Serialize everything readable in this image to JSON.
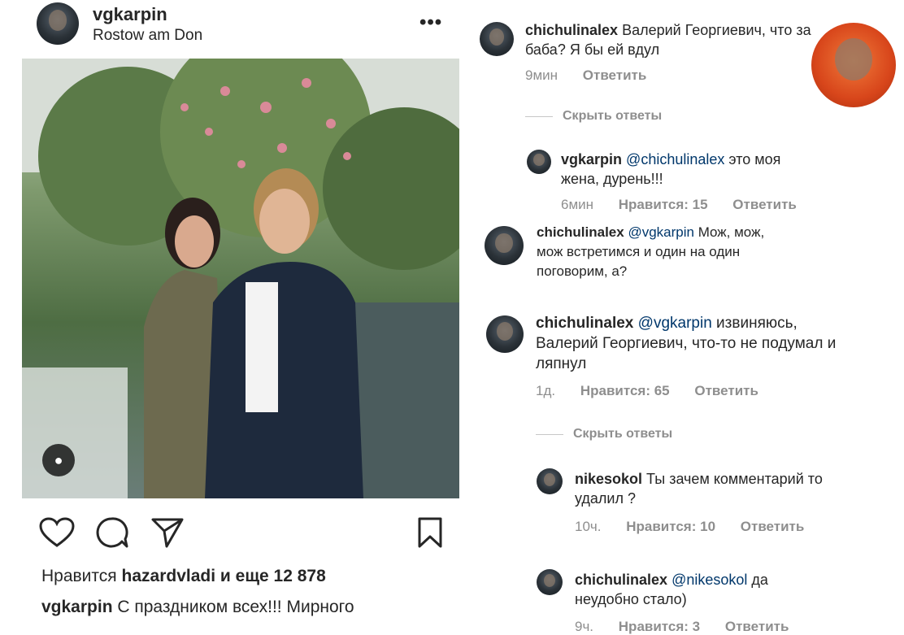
{
  "post": {
    "username": "vgkarpin",
    "location": "Rostow am Don",
    "more_icon": "more-dots-icon",
    "likes_prefix": "Нравится",
    "likes_user": "hazardvladi",
    "likes_suffix": "и еще 12 878",
    "caption_user": "vgkarpin",
    "caption_text": "С праздником всех!!! Мирного"
  },
  "comments": [
    {
      "user": "chichulinalex",
      "mention": "",
      "text": "Валерий Георгиевич, что за баба? Я бы ей вдул",
      "time": "9мин",
      "likes": "",
      "reply": "Ответить"
    },
    {
      "user": "vgkarpin",
      "mention": "@chichulinalex",
      "text": "это моя жена, дурень!!!",
      "time": "6мин",
      "likes": "Нравится: 15",
      "reply": "Ответить"
    },
    {
      "user": "chichulinalex",
      "mention": "@vgkarpin",
      "text": "Мож, мож, мож встретимся и один на один поговорим, а?",
      "time": "",
      "likes": "",
      "reply": ""
    },
    {
      "user": "chichulinalex",
      "mention": "@vgkarpin",
      "text": "извиняюсь, Валерий Георгиевич, что-то не подумал и ляпнул",
      "time": "1д.",
      "likes": "Нравится: 65",
      "reply": "Ответить"
    },
    {
      "user": "nikesokol",
      "mention": "",
      "text": "Ты зачем комментарий то удалил ?",
      "time": "10ч.",
      "likes": "Нравится: 10",
      "reply": "Ответить"
    },
    {
      "user": "chichulinalex",
      "mention": "@nikesokol",
      "text": "да неудобно стало)",
      "time": "9ч.",
      "likes": "Нравится: 3",
      "reply": "Ответить"
    }
  ],
  "hide_replies": "Скрыть ответы",
  "colors": {
    "mention": "#00376b",
    "muted": "#8e8e8e",
    "text": "#262626"
  }
}
